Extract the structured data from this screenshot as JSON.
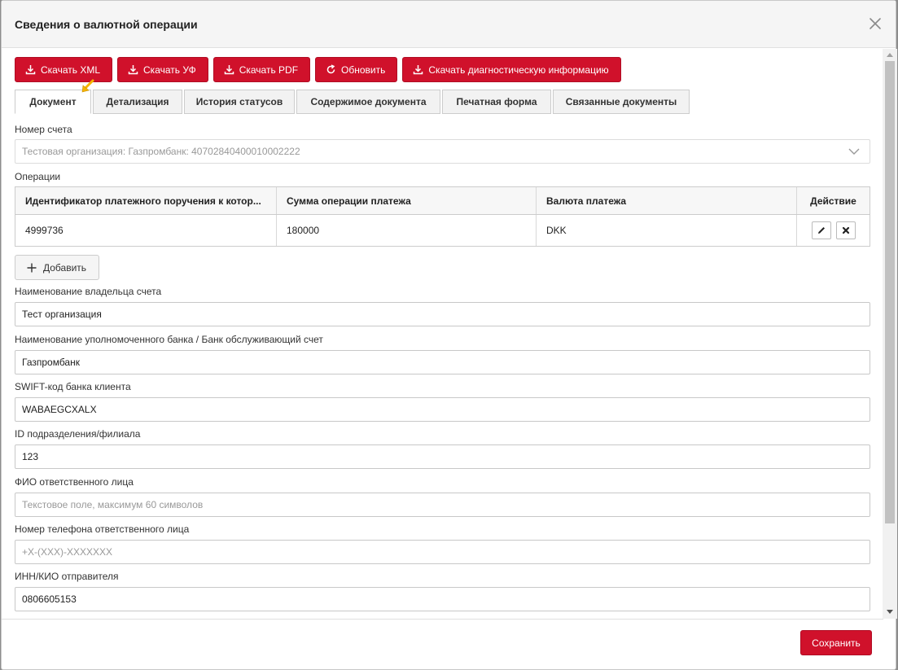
{
  "dialog": {
    "title": "Сведения о валютной операции"
  },
  "toolbar": {
    "buttons": [
      {
        "label": "Скачать XML",
        "icon": "download-icon"
      },
      {
        "label": "Скачать УФ",
        "icon": "download-icon"
      },
      {
        "label": "Скачать PDF",
        "icon": "download-icon"
      },
      {
        "label": "Обновить",
        "icon": "refresh-icon"
      },
      {
        "label": "Скачать диагностическую информацию",
        "icon": "download-icon"
      }
    ]
  },
  "tabs": [
    {
      "label": "Документ",
      "active": true
    },
    {
      "label": "Детализация"
    },
    {
      "label": "История статусов"
    },
    {
      "label": "Содержимое документа"
    },
    {
      "label": "Печатная форма"
    },
    {
      "label": "Связанные документы"
    }
  ],
  "form": {
    "account": {
      "label": "Номер счета",
      "value": "Тестовая организация: Газпромбанк: 40702840400010002222"
    },
    "operations": {
      "label": "Операции",
      "columns": [
        "Идентификатор платежного поручения к котор...",
        "Сумма операции платежа",
        "Валюта платежа",
        "Действие"
      ],
      "rows": [
        {
          "id": "4999736",
          "amount": "180000",
          "currency": "DKK"
        }
      ],
      "add_label": "Добавить"
    },
    "owner_name": {
      "label": "Наименование владельца счета",
      "value": "Тест организация"
    },
    "bank_name": {
      "label": "Наименование уполномоченного банка / Банк обслуживающий счет",
      "value": "Газпромбанк"
    },
    "swift": {
      "label": "SWIFT-код банка клиента",
      "value": "WABAEGCXALX"
    },
    "branch_id": {
      "label": "ID подразделения/филиала",
      "value": "123"
    },
    "responsible_name": {
      "label": "ФИО ответственного лица",
      "placeholder": "Текстовое поле, максимум 60 символов"
    },
    "responsible_phone": {
      "label": "Номер телефона ответственного лица",
      "placeholder": "+X-(XXX)-XXXXXXX"
    },
    "inn": {
      "label": "ИНН/КИО отправителя",
      "value": "0806605153"
    }
  },
  "footer": {
    "save_label": "Сохранить"
  },
  "colors": {
    "accent": "#d0112b",
    "pointer": "#f5b400"
  }
}
